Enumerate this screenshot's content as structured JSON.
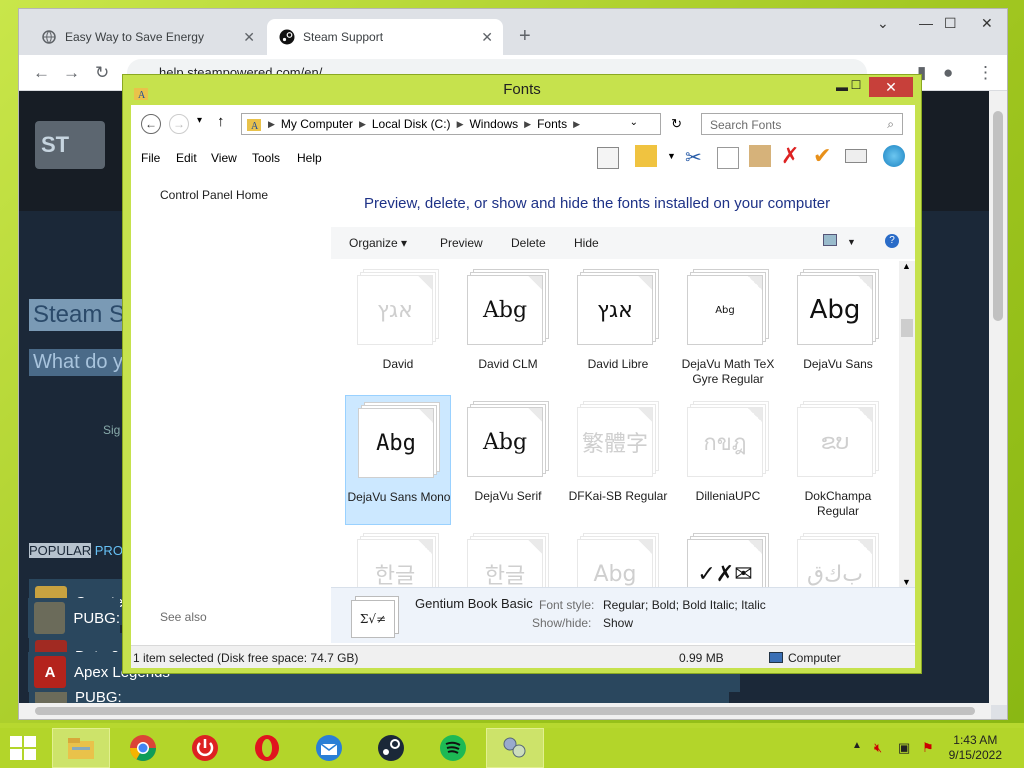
{
  "browser": {
    "tabs": [
      {
        "title": "Easy Way to Save Energy",
        "active": false
      },
      {
        "title": "Steam Support",
        "active": true
      }
    ],
    "new_tab": "+",
    "url": "help.steampowered.com/en/"
  },
  "steam": {
    "logo_text": "ST",
    "title": "Steam S",
    "subtitle": "What do y",
    "sign": "Sig",
    "popular_label": "POPULAR",
    "popular_label2": "PRO",
    "games": [
      "Counte",
      "Dota 2",
      "PUBG:",
      "Apex Legends"
    ]
  },
  "explorer": {
    "title": "Fonts",
    "address": [
      "My Computer",
      "Local Disk (C:)",
      "Windows",
      "Fonts"
    ],
    "search_placeholder": "Search Fonts",
    "menu": [
      "File",
      "Edit",
      "View",
      "Tools",
      "Help"
    ],
    "control_panel_home": "Control Panel Home",
    "see_also": "See also",
    "heading": "Preview, delete, or show and hide the fonts installed on your computer",
    "commands": {
      "organize": "Organize",
      "preview": "Preview",
      "delete": "Delete",
      "hide": "Hide"
    },
    "fonts": [
      {
        "name": "David",
        "sample": "אגץ",
        "faded": true
      },
      {
        "name": "David CLM",
        "sample": "Abg",
        "faded": false
      },
      {
        "name": "David Libre",
        "sample": "אגץ",
        "faded": false
      },
      {
        "name": "DejaVu Math TeX Gyre Regular",
        "sample": "Abg",
        "faded": false,
        "small": true
      },
      {
        "name": "DejaVu Sans",
        "sample": "Abg",
        "faded": false
      },
      {
        "name": "DejaVu Sans Mono",
        "sample": "Abg",
        "faded": false,
        "selected": true
      },
      {
        "name": "DejaVu Serif",
        "sample": "Abg",
        "faded": false
      },
      {
        "name": "DFKai-SB Regular",
        "sample": "繁體字",
        "faded": true
      },
      {
        "name": "DilleniaUPC",
        "sample": "กขฎ",
        "faded": true
      },
      {
        "name": "DokChampa Regular",
        "sample": "ຂບ",
        "faded": true
      },
      {
        "name": "",
        "sample": "한글",
        "faded": true
      },
      {
        "name": "",
        "sample": "한글",
        "faded": true
      },
      {
        "name": "",
        "sample": "Abg",
        "faded": true
      },
      {
        "name": "",
        "sample": "✓✗✉",
        "faded": false
      },
      {
        "name": "",
        "sample": "ﺏﻙﻕ",
        "faded": true
      }
    ],
    "detail": {
      "font_name": "Gentium Book Basic",
      "sample": "Σ√≠",
      "style_label": "Font style:",
      "style_value": "Regular; Bold; Bold Italic; Italic",
      "showhide_label": "Show/hide:",
      "showhide_value": "Show"
    },
    "status": {
      "selection": "1 item selected (Disk free space: 74.7 GB)",
      "size": "0.99 MB",
      "location": "Computer"
    }
  },
  "taskbar": {
    "time": "1:43 AM",
    "date": "9/15/2022"
  },
  "colors": {
    "steam_bg": "#1b2838",
    "explorer_frame": "#c6e24d",
    "close_red": "#c7403a",
    "heading_blue": "#1e3287"
  }
}
